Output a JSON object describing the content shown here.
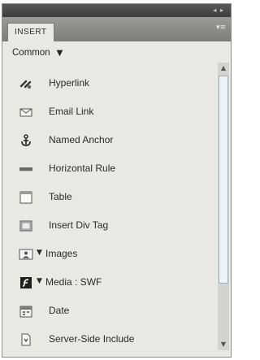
{
  "panel": {
    "tab_label": "INSERT",
    "category": "Common",
    "items": [
      {
        "label": "Hyperlink"
      },
      {
        "label": "Email Link"
      },
      {
        "label": "Named Anchor"
      },
      {
        "label": "Horizontal Rule"
      },
      {
        "label": "Table"
      },
      {
        "label": "Insert Div Tag"
      },
      {
        "label": "Images"
      },
      {
        "label": "Media : SWF"
      },
      {
        "label": "Date"
      },
      {
        "label": "Server-Side Include"
      }
    ]
  },
  "icons": [
    "hyperlink-icon",
    "email-link-icon",
    "named-anchor-icon",
    "horizontal-rule-icon",
    "table-icon",
    "insert-div-tag-icon",
    "images-icon",
    "media-swf-icon",
    "date-icon",
    "server-side-include-icon",
    "chevron-down-icon"
  ]
}
